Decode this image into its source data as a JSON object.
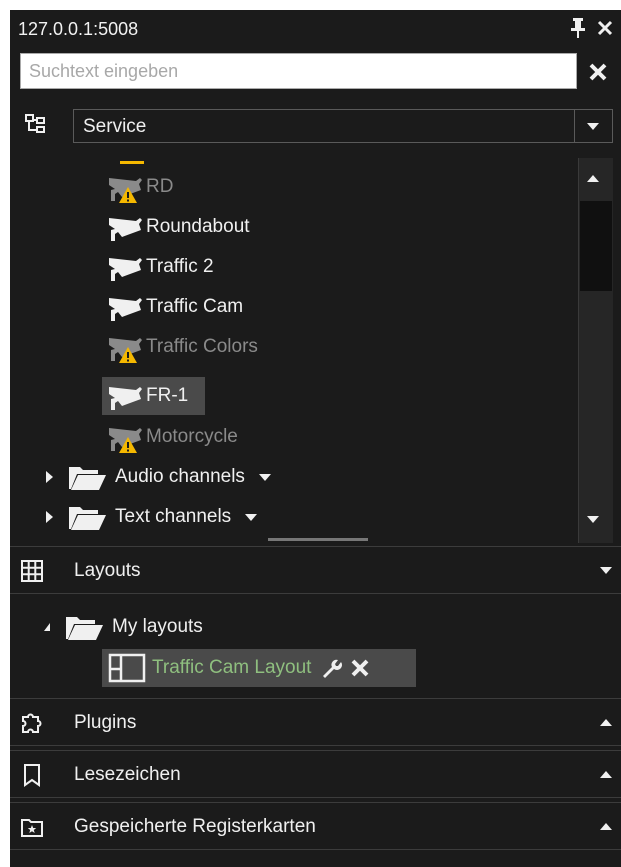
{
  "window": {
    "title": "127.0.0.1:5008"
  },
  "search": {
    "placeholder": "Suchtext eingeben"
  },
  "view_selector": {
    "value": "Service"
  },
  "tree": {
    "items": [
      {
        "label": "RD",
        "icon": "camera-warning-icon",
        "state": "warning"
      },
      {
        "label": "Roundabout",
        "icon": "camera-icon",
        "state": "ok"
      },
      {
        "label": "Traffic 2",
        "icon": "camera-icon",
        "state": "ok"
      },
      {
        "label": "Traffic Cam",
        "icon": "camera-icon",
        "state": "ok"
      },
      {
        "label": "Traffic Colors",
        "icon": "camera-warning-icon",
        "state": "warning"
      },
      {
        "label": "FR-1",
        "icon": "camera-icon",
        "state": "selected"
      },
      {
        "label": "Motorcycle",
        "icon": "camera-warning-icon",
        "state": "warning"
      }
    ],
    "groups": [
      {
        "label": "Audio channels",
        "icon": "folder-icon"
      },
      {
        "label": "Text channels",
        "icon": "folder-icon"
      }
    ]
  },
  "layouts": {
    "header": "Layouts",
    "folder": "My layouts",
    "item": {
      "label": "Traffic Cam Layout",
      "color": "#8fbf7f"
    }
  },
  "sections": [
    {
      "label": "Plugins",
      "icon": "puzzle-icon"
    },
    {
      "label": "Lesezeichen",
      "icon": "bookmark-icon"
    },
    {
      "label": "Gespeicherte Registerkarten",
      "icon": "saved-tab-icon"
    }
  ],
  "colors": {
    "panel_bg": "#1b1b1b",
    "warning": "#f5b800",
    "selected_bg": "#4a4a4a"
  }
}
